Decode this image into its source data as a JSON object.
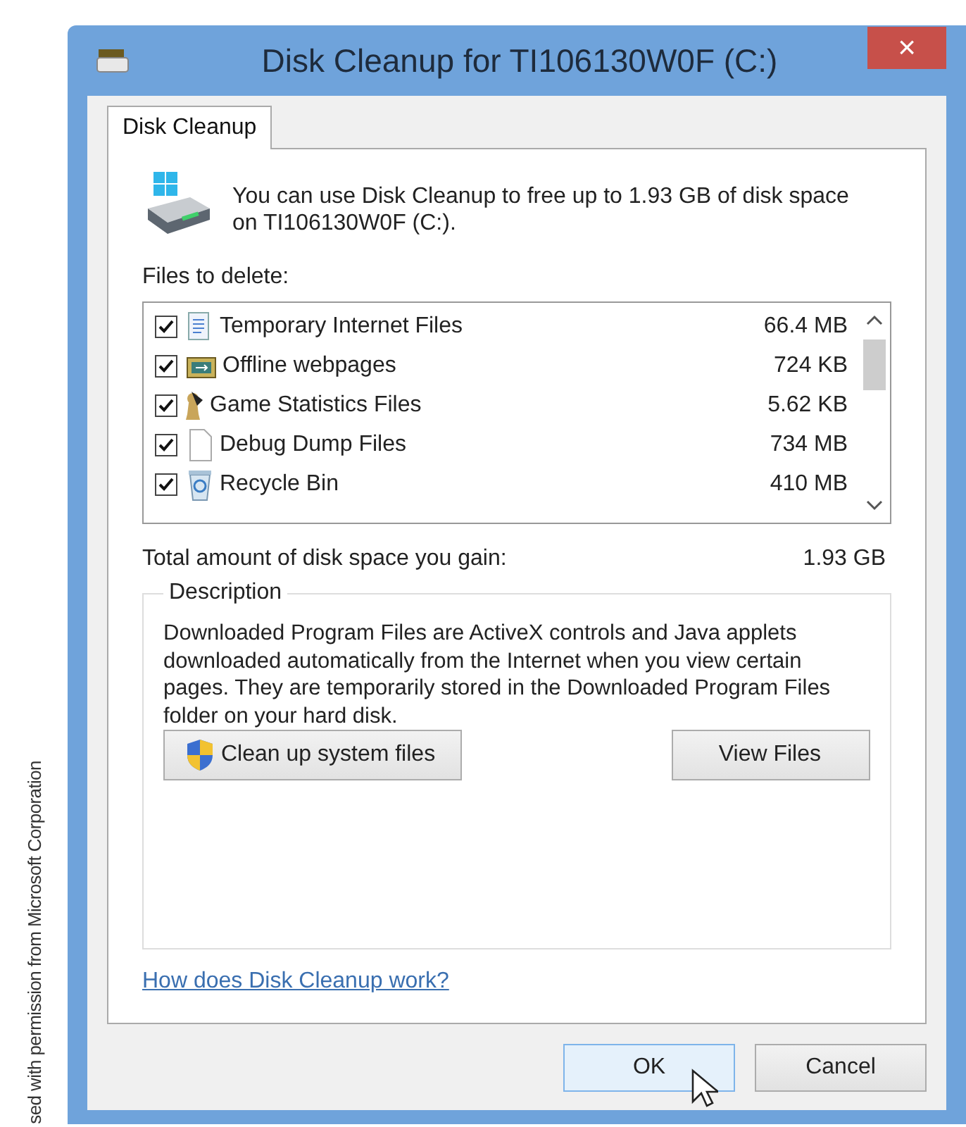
{
  "credit": "sed with permission from Microsoft Corporation",
  "window": {
    "title": "Disk Cleanup for TI106130W0F (C:)",
    "close": "×"
  },
  "tabs": [
    {
      "label": "Disk Cleanup",
      "selected": true
    }
  ],
  "intro": "You can use Disk Cleanup to free up to 1.93 GB of disk space on TI106130W0F (C:).",
  "files_label": "Files to delete:",
  "files": [
    {
      "name": "Temporary Internet Files",
      "size": "66.4 MB",
      "checked": true
    },
    {
      "name": "Offline webpages",
      "size": "724 KB",
      "checked": true
    },
    {
      "name": "Game Statistics Files",
      "size": "5.62 KB",
      "checked": true
    },
    {
      "name": "Debug Dump Files",
      "size": "734 MB",
      "checked": true
    },
    {
      "name": "Recycle Bin",
      "size": "410 MB",
      "checked": true
    }
  ],
  "total": {
    "label": "Total amount of disk space you gain:",
    "value": "1.93 GB"
  },
  "description": {
    "title": "Description",
    "text": "Downloaded Program Files are ActiveX controls and Java applets downloaded automatically from the Internet when you view certain pages. They are temporarily stored in the Downloaded Program Files folder on your hard disk."
  },
  "actions": [
    {
      "label": "Clean up system files",
      "kind": "shield"
    },
    {
      "label": "View Files",
      "kind": "plain"
    }
  ],
  "help_link": "How does Disk Cleanup work?",
  "buttons": [
    {
      "label": "OK",
      "default": true
    },
    {
      "label": "Cancel",
      "default": false
    }
  ]
}
